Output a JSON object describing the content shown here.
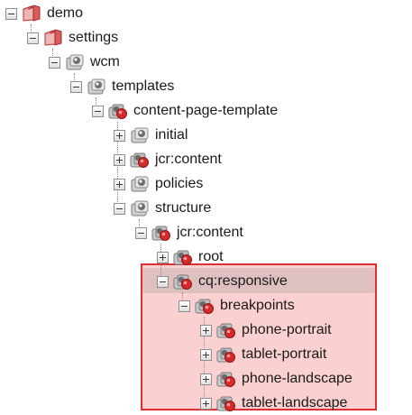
{
  "tree": {
    "nodes": [
      {
        "label": "demo",
        "icon": "folder-icon",
        "expanded": true
      },
      {
        "label": "settings",
        "icon": "folder-icon",
        "expanded": true
      },
      {
        "label": "wcm",
        "icon": "node-icon",
        "expanded": true
      },
      {
        "label": "templates",
        "icon": "node-icon",
        "expanded": true
      },
      {
        "label": "content-page-template",
        "icon": "component-icon",
        "expanded": true
      },
      {
        "label": "initial",
        "icon": "node-icon",
        "expanded": false
      },
      {
        "label": "jcr:content",
        "icon": "component-icon",
        "expanded": false
      },
      {
        "label": "policies",
        "icon": "node-icon",
        "expanded": false
      },
      {
        "label": "structure",
        "icon": "node-icon",
        "expanded": true
      },
      {
        "label": "jcr:content",
        "icon": "component-icon",
        "expanded": true
      },
      {
        "label": "root",
        "icon": "component-icon",
        "expanded": false
      },
      {
        "label": "cq:responsive",
        "icon": "component-icon",
        "expanded": true,
        "selected": true
      },
      {
        "label": "breakpoints",
        "icon": "component-icon",
        "expanded": true
      },
      {
        "label": "phone-portrait",
        "icon": "component-icon",
        "expanded": false
      },
      {
        "label": "tablet-portrait",
        "icon": "component-icon",
        "expanded": false
      },
      {
        "label": "phone-landscape",
        "icon": "component-icon",
        "expanded": false
      },
      {
        "label": "tablet-landscape",
        "icon": "component-icon",
        "expanded": false
      }
    ]
  },
  "colors": {
    "highlight_fill": "#f4b4b4",
    "highlight_border": "#e03030",
    "folder": "#c94a4a",
    "component_red": "#d42a2a",
    "node_gray": "#9a9a9a"
  }
}
